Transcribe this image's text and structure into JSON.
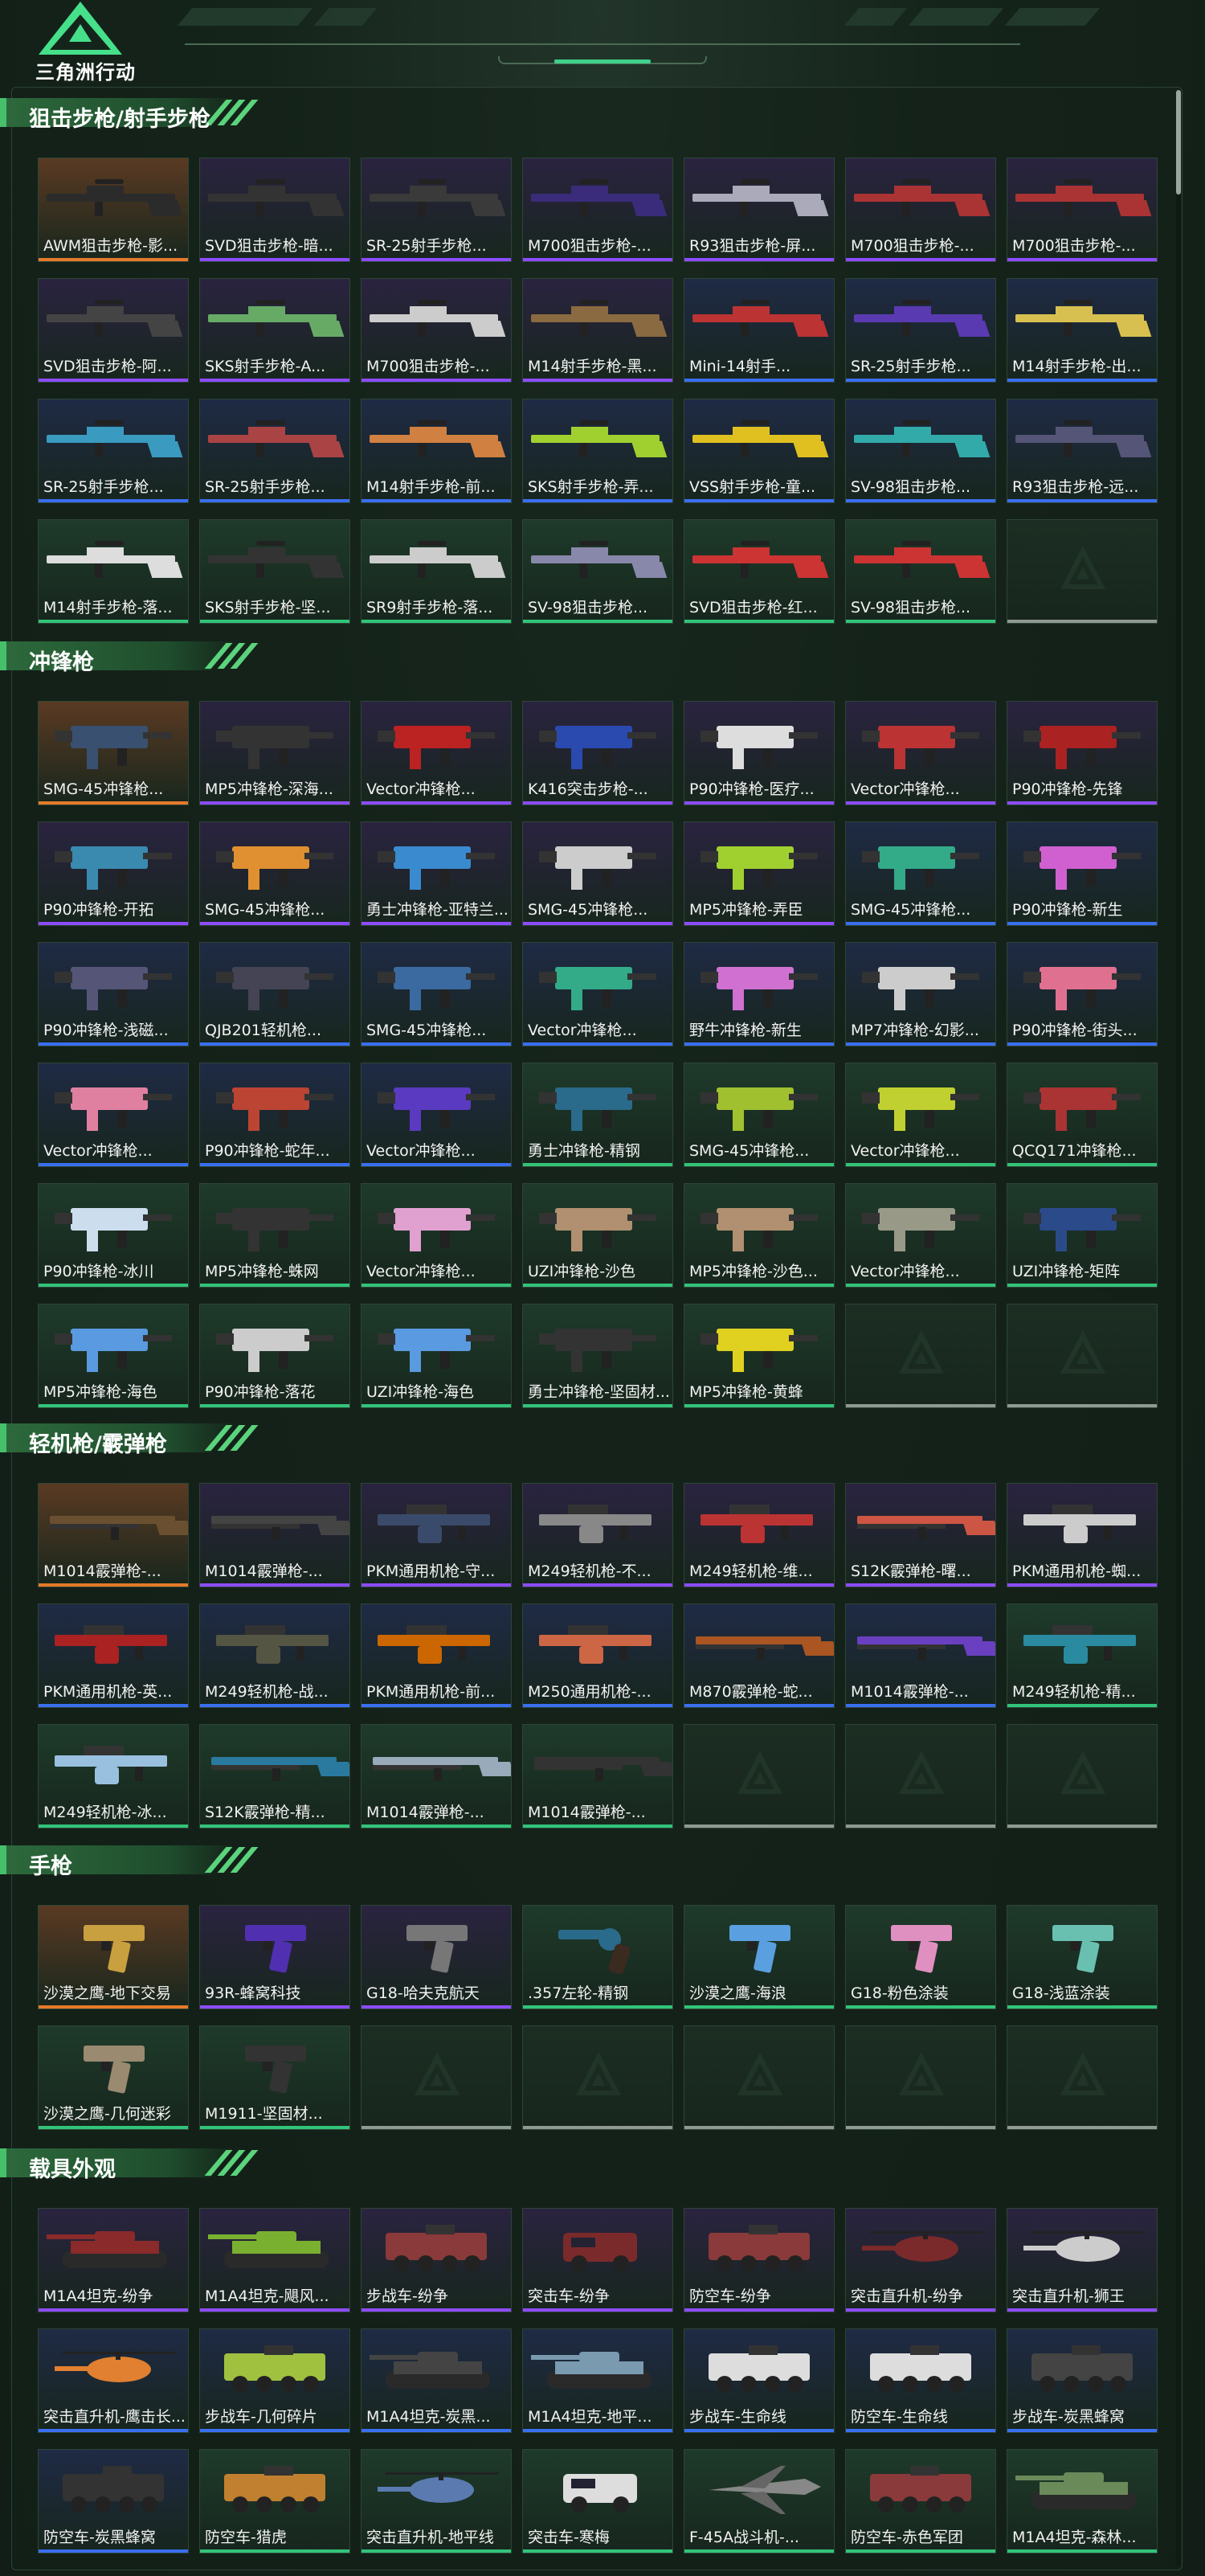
{
  "app": {
    "logo_text": "三角洲行动"
  },
  "colors": {
    "orange": "#e57a2a",
    "purple": "#8d4cff",
    "blue": "#3a6ff0",
    "green": "#32c47a",
    "grey": "#8e9a92"
  },
  "sections": [
    {
      "title": "狙击步枪/射手步枪",
      "items": [
        {
          "label": "AWM狙击步枪-影...",
          "rarity": "orange",
          "kind": "rifle",
          "color": "#2b2b2b"
        },
        {
          "label": "SVD狙击步枪-暗...",
          "rarity": "purple",
          "kind": "rifle",
          "color": "#333"
        },
        {
          "label": "SR-25射手步枪...",
          "rarity": "purple",
          "kind": "rifle",
          "color": "#3a3a3a"
        },
        {
          "label": "M700狙击步枪-...",
          "rarity": "purple",
          "kind": "rifle",
          "color": "#3a2c7a"
        },
        {
          "label": "R93狙击步枪-屏...",
          "rarity": "purple",
          "kind": "rifle",
          "color": "#aab"
        },
        {
          "label": "M700狙击步枪-...",
          "rarity": "purple",
          "kind": "rifle",
          "color": "#a33"
        },
        {
          "label": "M700狙击步枪-...",
          "rarity": "purple",
          "kind": "rifle",
          "color": "#a33"
        },
        {
          "label": "SVD狙击步枪-阿...",
          "rarity": "purple",
          "kind": "rifle",
          "color": "#444"
        },
        {
          "label": "SKS射手步枪-A...",
          "rarity": "purple",
          "kind": "rifle",
          "color": "#6a6"
        },
        {
          "label": "M700狙击步枪-...",
          "rarity": "purple",
          "kind": "rifle",
          "color": "#ccc"
        },
        {
          "label": "M14射手步枪-黑...",
          "rarity": "purple",
          "kind": "rifle",
          "color": "#8a6a40"
        },
        {
          "label": "Mini-14射手...",
          "rarity": "blue",
          "kind": "rifle",
          "color": "#b33"
        },
        {
          "label": "SR-25射手步枪...",
          "rarity": "blue",
          "kind": "rifle",
          "color": "#5a3ab0"
        },
        {
          "label": "M14射手步枪-出...",
          "rarity": "blue",
          "kind": "rifle",
          "color": "#d8c050"
        },
        {
          "label": "SR-25射手步枪...",
          "rarity": "blue",
          "kind": "rifle",
          "color": "#3a9ac0"
        },
        {
          "label": "SR-25射手步枪...",
          "rarity": "blue",
          "kind": "rifle",
          "color": "#a44"
        },
        {
          "label": "M14射手步枪-前...",
          "rarity": "blue",
          "kind": "rifle",
          "color": "#d08040"
        },
        {
          "label": "SKS射手步枪-弄...",
          "rarity": "blue",
          "kind": "rifle",
          "color": "#a0d030"
        },
        {
          "label": "VSS射手步枪-童...",
          "rarity": "blue",
          "kind": "rifle",
          "color": "#e0c020"
        },
        {
          "label": "SV-98狙击步枪...",
          "rarity": "blue",
          "kind": "rifle",
          "color": "#3aa"
        },
        {
          "label": "R93狙击步枪-远...",
          "rarity": "blue",
          "kind": "rifle",
          "color": "#557"
        },
        {
          "label": "M14射手步枪-落...",
          "rarity": "green",
          "kind": "rifle",
          "color": "#ddd"
        },
        {
          "label": "SKS射手步枪-坚...",
          "rarity": "green",
          "kind": "rifle",
          "color": "#333"
        },
        {
          "label": "SR9射手步枪-落...",
          "rarity": "green",
          "kind": "rifle",
          "color": "#ccc"
        },
        {
          "label": "SV-98狙击步枪...",
          "rarity": "green",
          "kind": "rifle",
          "color": "#88a"
        },
        {
          "label": "SVD狙击步枪-红...",
          "rarity": "green",
          "kind": "rifle",
          "color": "#c33"
        },
        {
          "label": "SV-98狙击步枪...",
          "rarity": "green",
          "kind": "rifle",
          "color": "#c33"
        },
        {
          "label": "",
          "rarity": "grey",
          "kind": "empty"
        }
      ]
    },
    {
      "title": "冲锋枪",
      "items": [
        {
          "label": "SMG-45冲锋枪...",
          "rarity": "orange",
          "kind": "smg",
          "color": "#3a5070"
        },
        {
          "label": "MP5冲锋枪-深海...",
          "rarity": "purple",
          "kind": "smg",
          "color": "#333"
        },
        {
          "label": "Vector冲锋枪...",
          "rarity": "purple",
          "kind": "smg",
          "color": "#b22"
        },
        {
          "label": "K416突击步枪-...",
          "rarity": "purple",
          "kind": "smg",
          "color": "#2a4ab0"
        },
        {
          "label": "P90冲锋枪-医疗...",
          "rarity": "purple",
          "kind": "smg",
          "color": "#ddd"
        },
        {
          "label": "Vector冲锋枪...",
          "rarity": "purple",
          "kind": "smg",
          "color": "#b33"
        },
        {
          "label": "P90冲锋枪-先锋",
          "rarity": "purple",
          "kind": "smg",
          "color": "#a22"
        },
        {
          "label": "P90冲锋枪-开拓",
          "rarity": "purple",
          "kind": "smg",
          "color": "#3a8ab0"
        },
        {
          "label": "SMG-45冲锋枪...",
          "rarity": "purple",
          "kind": "smg",
          "color": "#e09030"
        },
        {
          "label": "勇士冲锋枪-亚特兰...",
          "rarity": "purple",
          "kind": "smg",
          "color": "#3a8ad0"
        },
        {
          "label": "SMG-45冲锋枪...",
          "rarity": "purple",
          "kind": "smg",
          "color": "#ccc"
        },
        {
          "label": "MP5冲锋枪-弄臣",
          "rarity": "purple",
          "kind": "smg",
          "color": "#a0d030"
        },
        {
          "label": "SMG-45冲锋枪...",
          "rarity": "blue",
          "kind": "smg",
          "color": "#3a8"
        },
        {
          "label": "P90冲锋枪-新生",
          "rarity": "blue",
          "kind": "smg",
          "color": "#d060d0"
        },
        {
          "label": "P90冲锋枪-浅磁...",
          "rarity": "blue",
          "kind": "smg",
          "color": "#557"
        },
        {
          "label": "QJB201轻机枪...",
          "rarity": "blue",
          "kind": "smg",
          "color": "#445"
        },
        {
          "label": "SMG-45冲锋枪...",
          "rarity": "blue",
          "kind": "smg",
          "color": "#3a6aa0"
        },
        {
          "label": "Vector冲锋枪...",
          "rarity": "blue",
          "kind": "smg",
          "color": "#3a8"
        },
        {
          "label": "野牛冲锋枪-新生",
          "rarity": "blue",
          "kind": "smg",
          "color": "#d070d0"
        },
        {
          "label": "MP7冲锋枪-幻影...",
          "rarity": "blue",
          "kind": "smg",
          "color": "#ccc"
        },
        {
          "label": "P90冲锋枪-街头...",
          "rarity": "blue",
          "kind": "smg",
          "color": "#e07090"
        },
        {
          "label": "Vector冲锋枪...",
          "rarity": "blue",
          "kind": "smg",
          "color": "#e080a0"
        },
        {
          "label": "P90冲锋枪-蛇年...",
          "rarity": "blue",
          "kind": "smg",
          "color": "#b43"
        },
        {
          "label": "Vector冲锋枪...",
          "rarity": "blue",
          "kind": "smg",
          "color": "#5a3ac0"
        },
        {
          "label": "勇士冲锋枪-精钢",
          "rarity": "green",
          "kind": "smg",
          "color": "#2a6a8a"
        },
        {
          "label": "SMG-45冲锋枪...",
          "rarity": "green",
          "kind": "smg",
          "color": "#a0c030"
        },
        {
          "label": "Vector冲锋枪...",
          "rarity": "green",
          "kind": "smg",
          "color": "#c0d030"
        },
        {
          "label": "QCQ171冲锋枪...",
          "rarity": "green",
          "kind": "smg",
          "color": "#a33"
        },
        {
          "label": "P90冲锋枪-冰川",
          "rarity": "green",
          "kind": "smg",
          "color": "#cde"
        },
        {
          "label": "MP5冲锋枪-蛛网",
          "rarity": "green",
          "kind": "smg",
          "color": "#333"
        },
        {
          "label": "Vector冲锋枪...",
          "rarity": "green",
          "kind": "smg",
          "color": "#e0a0d0"
        },
        {
          "label": "UZI冲锋枪-沙色",
          "rarity": "green",
          "kind": "smg",
          "color": "#b09070"
        },
        {
          "label": "MP5冲锋枪-沙色...",
          "rarity": "green",
          "kind": "smg",
          "color": "#b09070"
        },
        {
          "label": "Vector冲锋枪...",
          "rarity": "green",
          "kind": "smg",
          "color": "#998"
        },
        {
          "label": "UZI冲锋枪-矩阵",
          "rarity": "green",
          "kind": "smg",
          "color": "#2a4a8a"
        },
        {
          "label": "MP5冲锋枪-海色",
          "rarity": "green",
          "kind": "smg",
          "color": "#5a9ae0"
        },
        {
          "label": "P90冲锋枪-落花",
          "rarity": "green",
          "kind": "smg",
          "color": "#ccc"
        },
        {
          "label": "UZI冲锋枪-海色",
          "rarity": "green",
          "kind": "smg",
          "color": "#5a9ae0"
        },
        {
          "label": "勇士冲锋枪-坚固材...",
          "rarity": "green",
          "kind": "smg",
          "color": "#333"
        },
        {
          "label": "MP5冲锋枪-黄蜂",
          "rarity": "green",
          "kind": "smg",
          "color": "#e0d020"
        },
        {
          "label": "",
          "rarity": "grey",
          "kind": "empty"
        },
        {
          "label": "",
          "rarity": "grey",
          "kind": "empty"
        }
      ]
    },
    {
      "title": "轻机枪/霰弹枪",
      "items": [
        {
          "label": "M1014霰弹枪-...",
          "rarity": "orange",
          "kind": "shotgun",
          "color": "#6a5030"
        },
        {
          "label": "M1014霰弹枪-...",
          "rarity": "purple",
          "kind": "shotgun",
          "color": "#444"
        },
        {
          "label": "PKM通用机枪-守...",
          "rarity": "purple",
          "kind": "lmg",
          "color": "#3a4a6a"
        },
        {
          "label": "M249轻机枪-不...",
          "rarity": "purple",
          "kind": "lmg",
          "color": "#888"
        },
        {
          "label": "M249轻机枪-维...",
          "rarity": "purple",
          "kind": "lmg",
          "color": "#b33"
        },
        {
          "label": "S12K霰弹枪-曙...",
          "rarity": "purple",
          "kind": "shotgun",
          "color": "#c54"
        },
        {
          "label": "PKM通用机枪-蜘...",
          "rarity": "purple",
          "kind": "lmg",
          "color": "#ccc"
        },
        {
          "label": "PKM通用机枪-英...",
          "rarity": "blue",
          "kind": "lmg",
          "color": "#a22"
        },
        {
          "label": "M249轻机枪-战...",
          "rarity": "blue",
          "kind": "lmg",
          "color": "#554"
        },
        {
          "label": "PKM通用机枪-前...",
          "rarity": "blue",
          "kind": "lmg",
          "color": "#c60"
        },
        {
          "label": "M250通用机枪-...",
          "rarity": "blue",
          "kind": "lmg",
          "color": "#c64"
        },
        {
          "label": "M870霰弹枪-蛇...",
          "rarity": "blue",
          "kind": "shotgun",
          "color": "#a52"
        },
        {
          "label": "M1014霰弹枪-...",
          "rarity": "blue",
          "kind": "shotgun",
          "color": "#6a40c0"
        },
        {
          "label": "M249轻机枪-精...",
          "rarity": "green",
          "kind": "lmg",
          "color": "#2a8aa0"
        },
        {
          "label": "M249轻机枪-冰...",
          "rarity": "green",
          "kind": "lmg",
          "color": "#9ac0e0"
        },
        {
          "label": "S12K霰弹枪-精...",
          "rarity": "green",
          "kind": "shotgun",
          "color": "#2a7aa0"
        },
        {
          "label": "M1014霰弹枪-...",
          "rarity": "green",
          "kind": "shotgun",
          "color": "#9ab"
        },
        {
          "label": "M1014霰弹枪-...",
          "rarity": "green",
          "kind": "shotgun",
          "color": "#333"
        },
        {
          "label": "",
          "rarity": "grey",
          "kind": "empty"
        },
        {
          "label": "",
          "rarity": "grey",
          "kind": "empty"
        },
        {
          "label": "",
          "rarity": "grey",
          "kind": "empty"
        }
      ]
    },
    {
      "title": "手枪",
      "items": [
        {
          "label": "沙漠之鹰-地下交易",
          "rarity": "orange",
          "kind": "pistol",
          "color": "#c9a040"
        },
        {
          "label": "93R-蜂窝科技",
          "rarity": "purple",
          "kind": "pistol",
          "color": "#5030b0"
        },
        {
          "label": "G18-哈夫克航天",
          "rarity": "purple",
          "kind": "pistol",
          "color": "#777"
        },
        {
          "label": ".357左轮-精钢",
          "rarity": "green",
          "kind": "revolver",
          "color": "#2a6a8a"
        },
        {
          "label": "沙漠之鹰-海浪",
          "rarity": "green",
          "kind": "pistol",
          "color": "#5aa0e0"
        },
        {
          "label": "G18-粉色涂装",
          "rarity": "green",
          "kind": "pistol",
          "color": "#e090c0"
        },
        {
          "label": "G18-浅蓝涂装",
          "rarity": "green",
          "kind": "pistol",
          "color": "#6ac0b0"
        },
        {
          "label": "沙漠之鹰-几何迷彩",
          "rarity": "green",
          "kind": "pistol",
          "color": "#998a70"
        },
        {
          "label": "M1911-坚固材...",
          "rarity": "green",
          "kind": "pistol",
          "color": "#333"
        },
        {
          "label": "",
          "rarity": "grey",
          "kind": "empty"
        },
        {
          "label": "",
          "rarity": "grey",
          "kind": "empty"
        },
        {
          "label": "",
          "rarity": "grey",
          "kind": "empty"
        },
        {
          "label": "",
          "rarity": "grey",
          "kind": "empty"
        },
        {
          "label": "",
          "rarity": "grey",
          "kind": "empty"
        }
      ]
    },
    {
      "title": "载具外观",
      "items": [
        {
          "label": "M1A4坦克-纷争",
          "rarity": "purple",
          "kind": "tank",
          "color": "#8a2a2a"
        },
        {
          "label": "M1A4坦克-飓风...",
          "rarity": "purple",
          "kind": "tank",
          "color": "#7ab030"
        },
        {
          "label": "步战车-纷争",
          "rarity": "purple",
          "kind": "ifv",
          "color": "#8a3a3a"
        },
        {
          "label": "突击车-纷争",
          "rarity": "purple",
          "kind": "car",
          "color": "#7a2a2a"
        },
        {
          "label": "防空车-纷争",
          "rarity": "purple",
          "kind": "ifv",
          "color": "#8a3a3a"
        },
        {
          "label": "突击直升机-纷争",
          "rarity": "purple",
          "kind": "heli",
          "color": "#7a2a2a"
        },
        {
          "label": "突击直升机-狮王",
          "rarity": "purple",
          "kind": "heli",
          "color": "#ccc"
        },
        {
          "label": "突击直升机-鹰击长...",
          "rarity": "blue",
          "kind": "heli",
          "color": "#e08030"
        },
        {
          "label": "步战车-几何碎片",
          "rarity": "blue",
          "kind": "ifv",
          "color": "#a0c040"
        },
        {
          "label": "M1A4坦克-炭黑...",
          "rarity": "blue",
          "kind": "tank",
          "color": "#444"
        },
        {
          "label": "M1A4坦克-地平...",
          "rarity": "blue",
          "kind": "tank",
          "color": "#7a9ab0"
        },
        {
          "label": "步战车-生命线",
          "rarity": "blue",
          "kind": "ifv",
          "color": "#ddd"
        },
        {
          "label": "防空车-生命线",
          "rarity": "blue",
          "kind": "ifv",
          "color": "#ddd"
        },
        {
          "label": "步战车-炭黑蜂窝",
          "rarity": "blue",
          "kind": "ifv",
          "color": "#444"
        },
        {
          "label": "防空车-炭黑蜂窝",
          "rarity": "blue",
          "kind": "ifv",
          "color": "#333"
        },
        {
          "label": "防空车-猎虎",
          "rarity": "green",
          "kind": "ifv",
          "color": "#c08030"
        },
        {
          "label": "突击直升机-地平线",
          "rarity": "green",
          "kind": "heli",
          "color": "#5a7ab0"
        },
        {
          "label": "突击车-寒梅",
          "rarity": "green",
          "kind": "car",
          "color": "#ddd"
        },
        {
          "label": "F-45A战斗机-...",
          "rarity": "green",
          "kind": "jet",
          "color": "#888"
        },
        {
          "label": "防空车-赤色军团",
          "rarity": "green",
          "kind": "ifv",
          "color": "#8a3a3a"
        },
        {
          "label": "M1A4坦克-森林...",
          "rarity": "green",
          "kind": "tank",
          "color": "#6a8a5a"
        }
      ]
    }
  ]
}
